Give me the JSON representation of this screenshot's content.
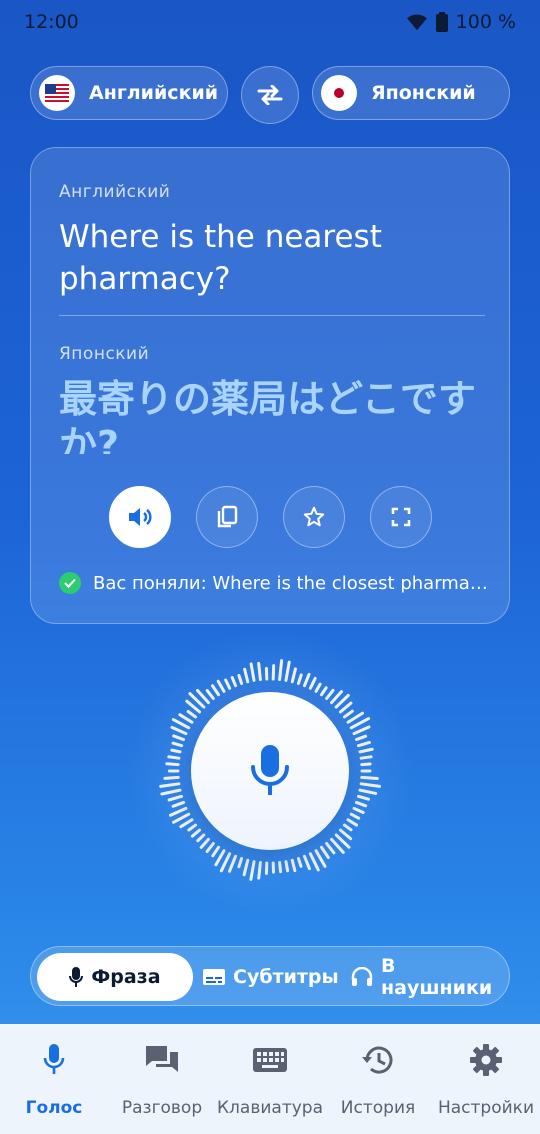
{
  "status": {
    "time": "12:00",
    "battery": "100 %"
  },
  "languages": {
    "source": "Английский",
    "target": "Японский"
  },
  "card": {
    "source_label": "Английский",
    "source_text": "Where is the nearest pharmacy?",
    "target_label": "Японский",
    "target_text": "最寄りの薬局はどこですか?",
    "recognized": "Вас поняли: Where is the closest pharmacy?"
  },
  "modes": [
    {
      "label": "Фраза",
      "icon": "mic-icon",
      "active": true
    },
    {
      "label": "Субтитры",
      "icon": "subtitles-icon",
      "active": false
    },
    {
      "label": "В наушники",
      "icon": "headphones-icon",
      "active": false
    }
  ],
  "nav": [
    {
      "label": "Голос",
      "icon": "mic-icon",
      "active": true
    },
    {
      "label": "Разговор",
      "icon": "chat-icon",
      "active": false
    },
    {
      "label": "Клавиатура",
      "icon": "keyboard-icon",
      "active": false
    },
    {
      "label": "История",
      "icon": "history-icon",
      "active": false
    },
    {
      "label": "Настройки",
      "icon": "gear-icon",
      "active": false
    }
  ],
  "colors": {
    "accent": "#1a6fe0",
    "success": "#2ecc71",
    "target_text": "#a9d4ff"
  }
}
